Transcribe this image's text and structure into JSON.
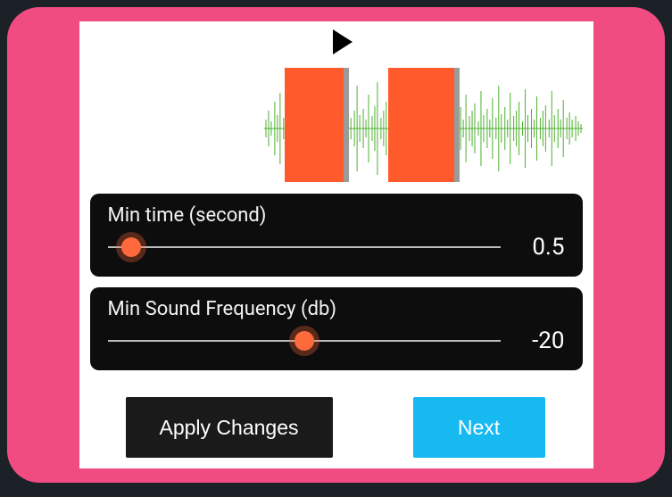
{
  "sliders": {
    "minTime": {
      "label": "Min time (second)",
      "value": "0.5",
      "thumbPct": 6
    },
    "minFreq": {
      "label": "Min Sound Frequency (db)",
      "value": "-20",
      "thumbPct": 50
    }
  },
  "buttons": {
    "apply": "Apply Changes",
    "next": "Next"
  },
  "colors": {
    "accent": "#ff6a3c",
    "nextBtn": "#16b9f0",
    "selection": "#ff5a2c",
    "waveform": "#4caf2d",
    "outerBg": "#f14c82"
  }
}
